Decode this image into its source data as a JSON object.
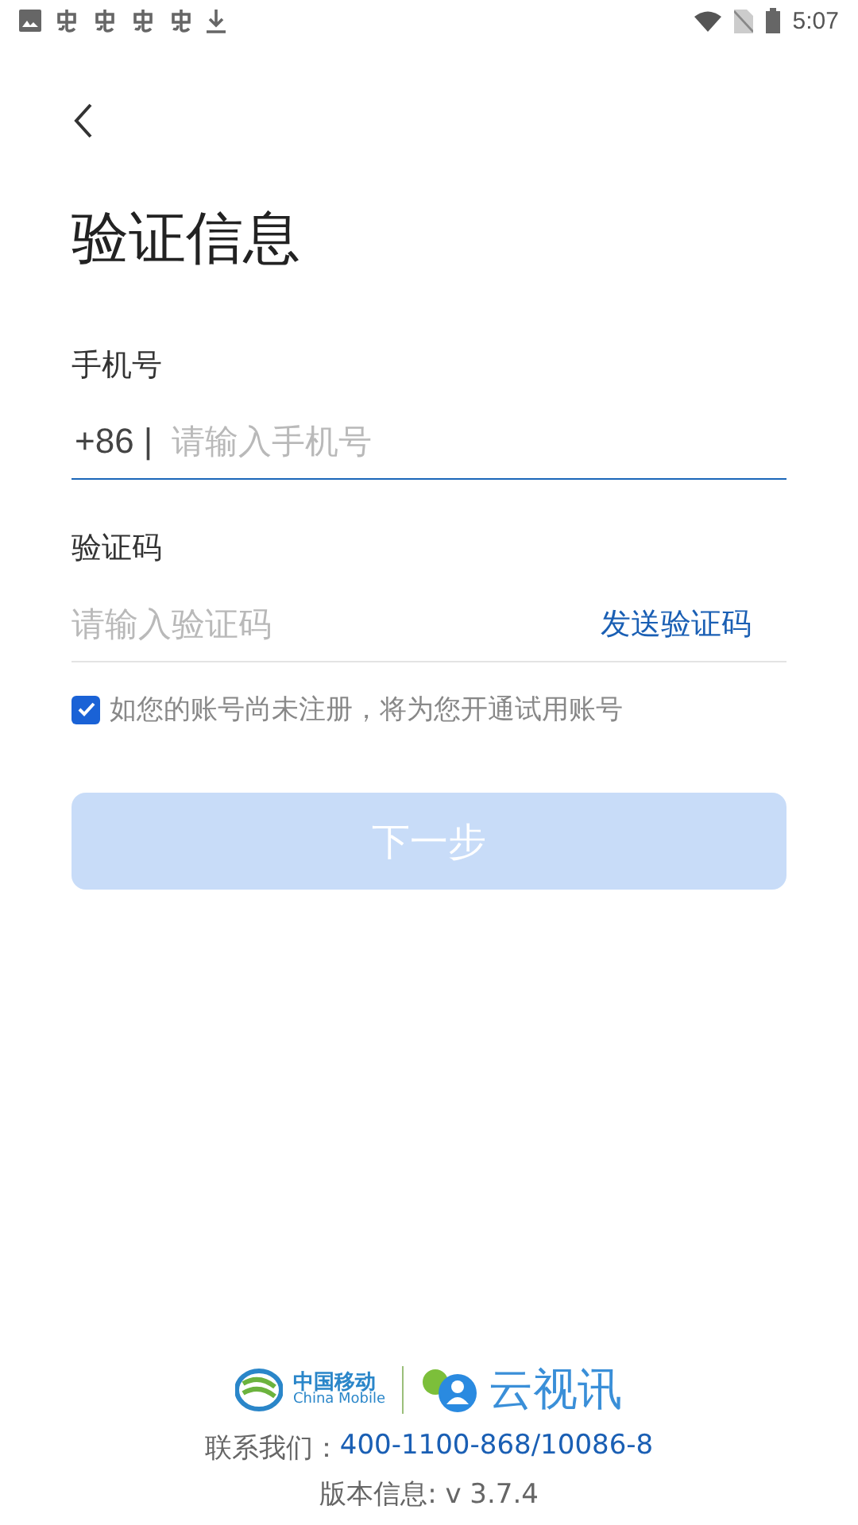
{
  "status_bar": {
    "time": "5:07"
  },
  "title": "验证信息",
  "phone": {
    "label": "手机号",
    "prefix": "+86 |",
    "placeholder": "请输入手机号",
    "focused": true
  },
  "code": {
    "label": "验证码",
    "placeholder": "请输入验证码",
    "send_link": "发送验证码"
  },
  "agreement": {
    "text": "如您的账号尚未注册，将为您开通试用账号",
    "checked": true
  },
  "next_button": {
    "label": "下一步",
    "disabled": true
  },
  "footer": {
    "brand_cn": "中国移动",
    "brand_en": "China Mobile",
    "app_name": "云视讯",
    "contact_label": "联系我们：",
    "contact_phone": "400-1100-868/10086-8",
    "version": "版本信息: v 3.7.4"
  }
}
